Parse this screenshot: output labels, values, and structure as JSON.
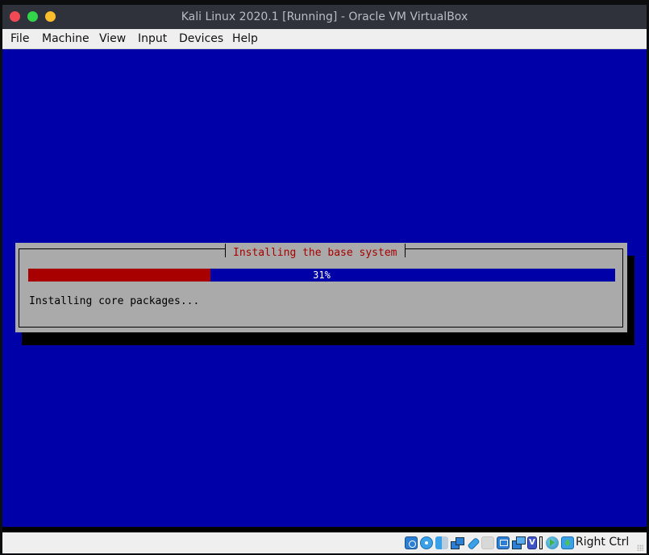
{
  "window": {
    "title": "Kali Linux 2020.1 [Running] - Oracle VM VirtualBox",
    "controls": [
      "close",
      "minimize",
      "maximize"
    ]
  },
  "menubar": {
    "items": [
      {
        "label": "File"
      },
      {
        "label": "Machine"
      },
      {
        "label": "View"
      },
      {
        "label": "Input"
      },
      {
        "label": "Devices"
      },
      {
        "label": "Help"
      }
    ]
  },
  "installer": {
    "dialog_title": "Installing the base system",
    "progress_percent": 31,
    "progress_label": "31%",
    "message": "Installing core packages...",
    "colors": {
      "background": "#0000a8",
      "dialog": "#aaaaaa",
      "progress_fill": "#a80000",
      "title_text": "#a80000"
    }
  },
  "statusbar": {
    "icons": [
      "hard-disk-icon",
      "optical-drive-icon",
      "audio-icon",
      "network-icon",
      "usb-icon",
      "shared-folders-icon",
      "display-icon",
      "video-capture-icon",
      "virtualization-icon",
      "mouse-integration-icon",
      "keyboard-capture-icon"
    ],
    "host_key": "Right Ctrl"
  }
}
